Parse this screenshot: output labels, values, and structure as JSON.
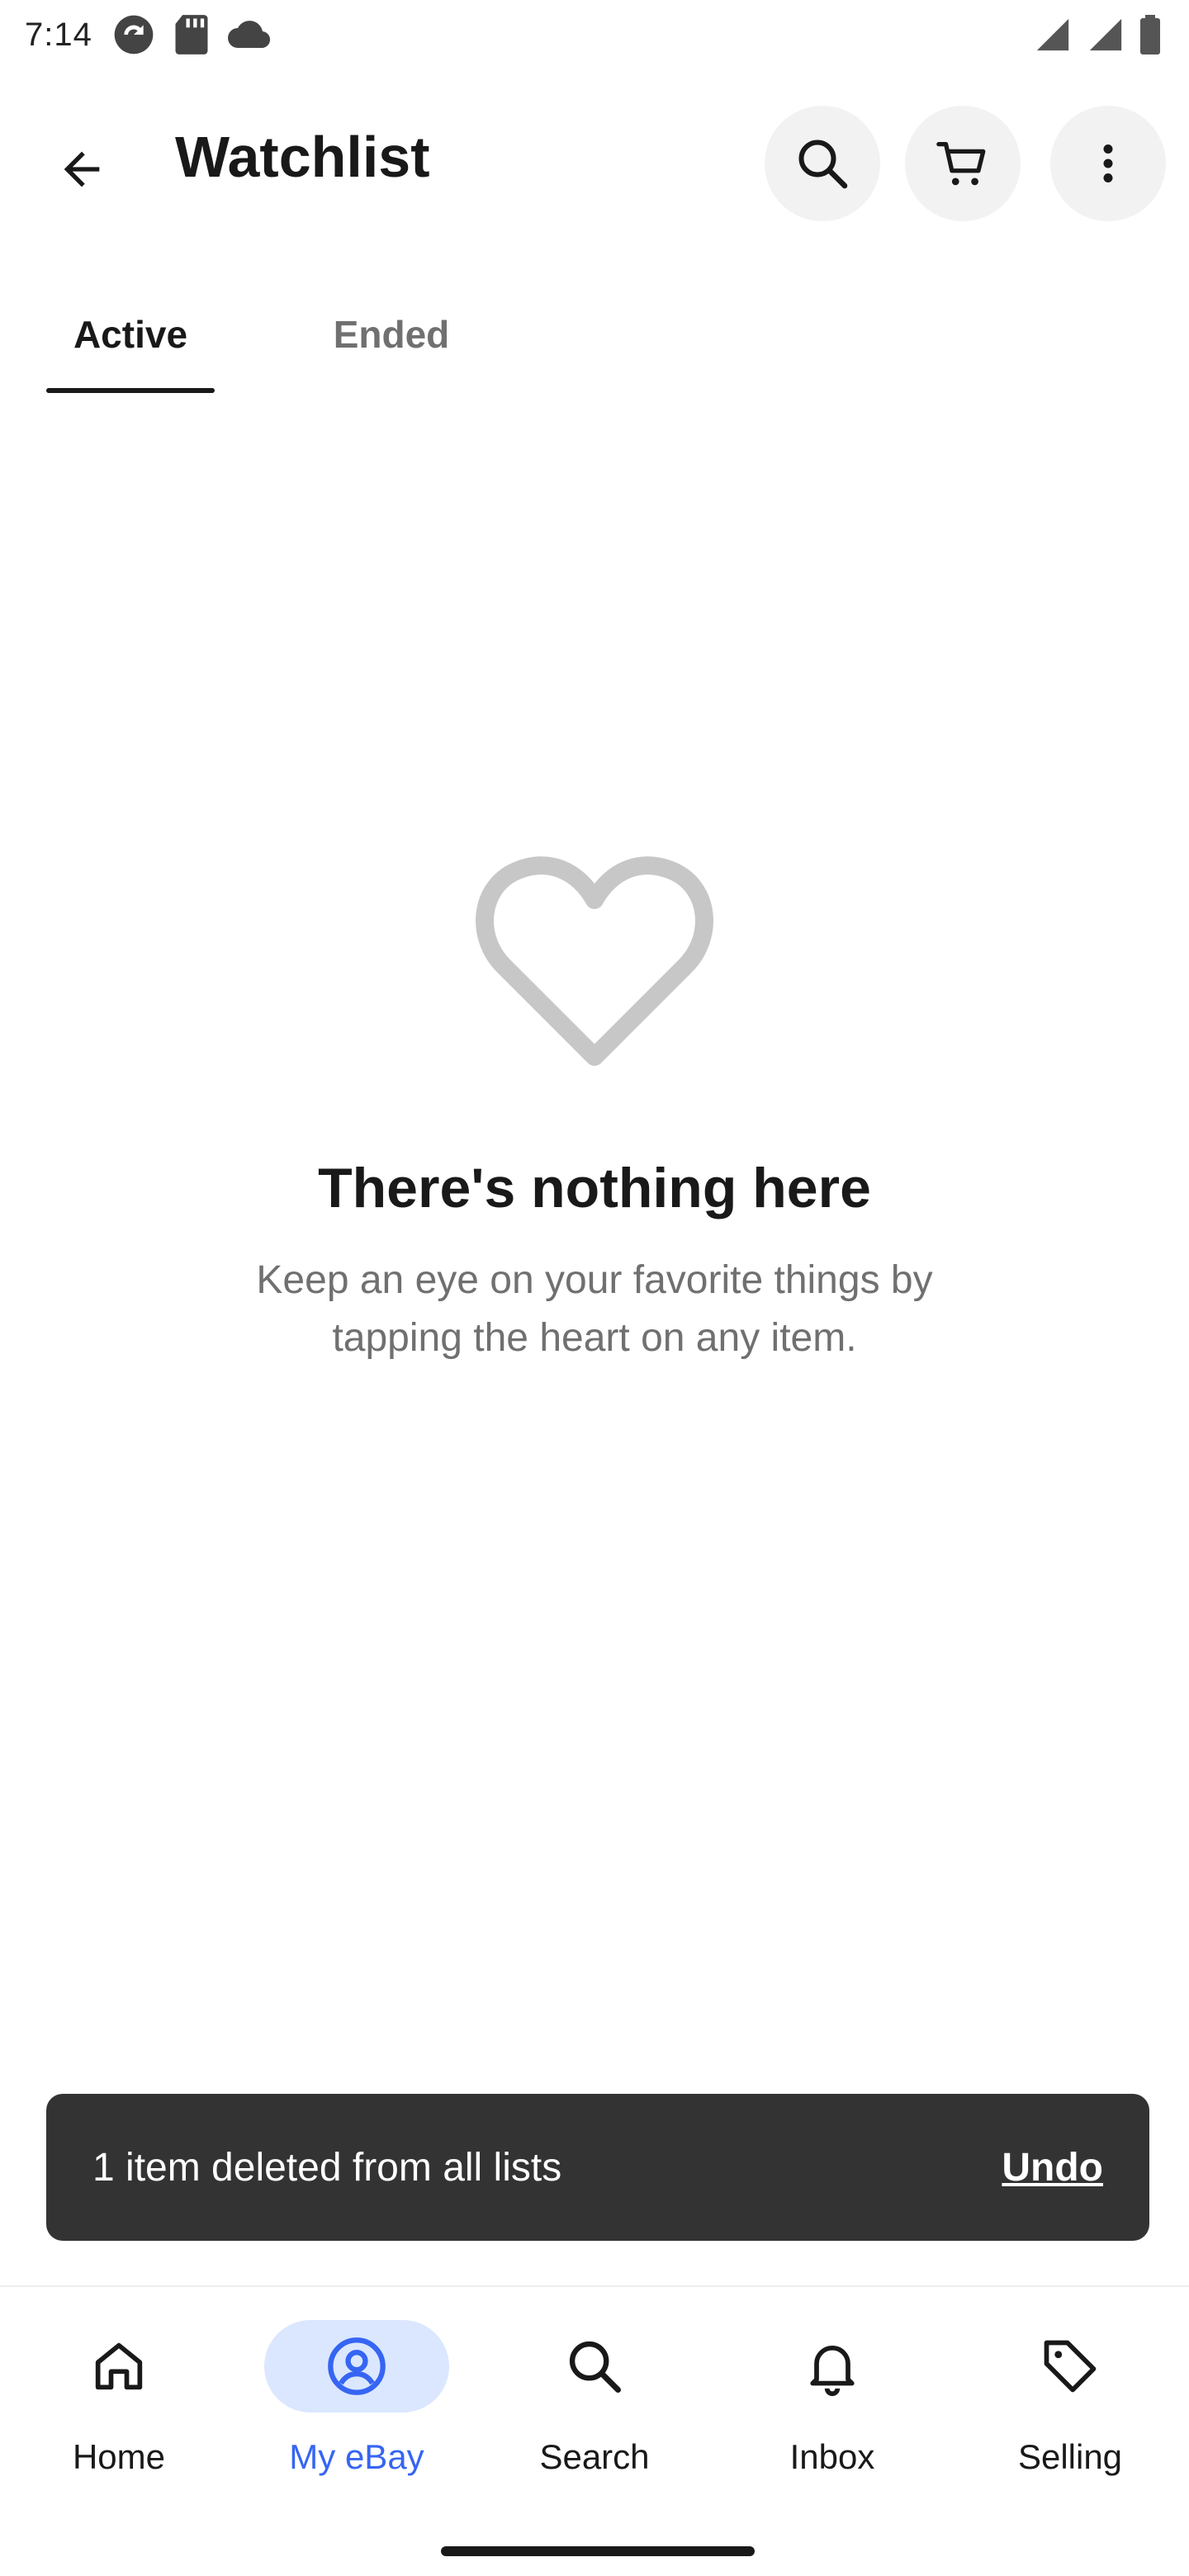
{
  "status_bar": {
    "time": "7:14"
  },
  "app_bar": {
    "title": "Watchlist",
    "icons": [
      "back-arrow-icon",
      "search-icon",
      "cart-icon",
      "more-vert-icon"
    ]
  },
  "tabs": [
    {
      "label": "Active",
      "selected": true
    },
    {
      "label": "Ended",
      "selected": false
    }
  ],
  "empty_state": {
    "icon": "heart-outline-icon",
    "title": "There's nothing here",
    "description": "Keep an eye on your favorite things by tapping the heart on any item."
  },
  "snackbar": {
    "message": "1 item deleted from all lists",
    "action": "Undo"
  },
  "bottom_nav": {
    "items": [
      {
        "label": "Home",
        "icon": "home-icon",
        "selected": false
      },
      {
        "label": "My eBay",
        "icon": "account-icon",
        "selected": true
      },
      {
        "label": "Search",
        "icon": "search-icon",
        "selected": false
      },
      {
        "label": "Inbox",
        "icon": "bell-icon",
        "selected": false
      },
      {
        "label": "Selling",
        "icon": "tag-icon",
        "selected": false
      }
    ]
  },
  "colors": {
    "accent": "#3665f3",
    "accent_bg": "#dbe7ff",
    "snackbar_bg": "#333333",
    "muted_text": "#707070",
    "heart_stroke": "#c7c7c7"
  }
}
